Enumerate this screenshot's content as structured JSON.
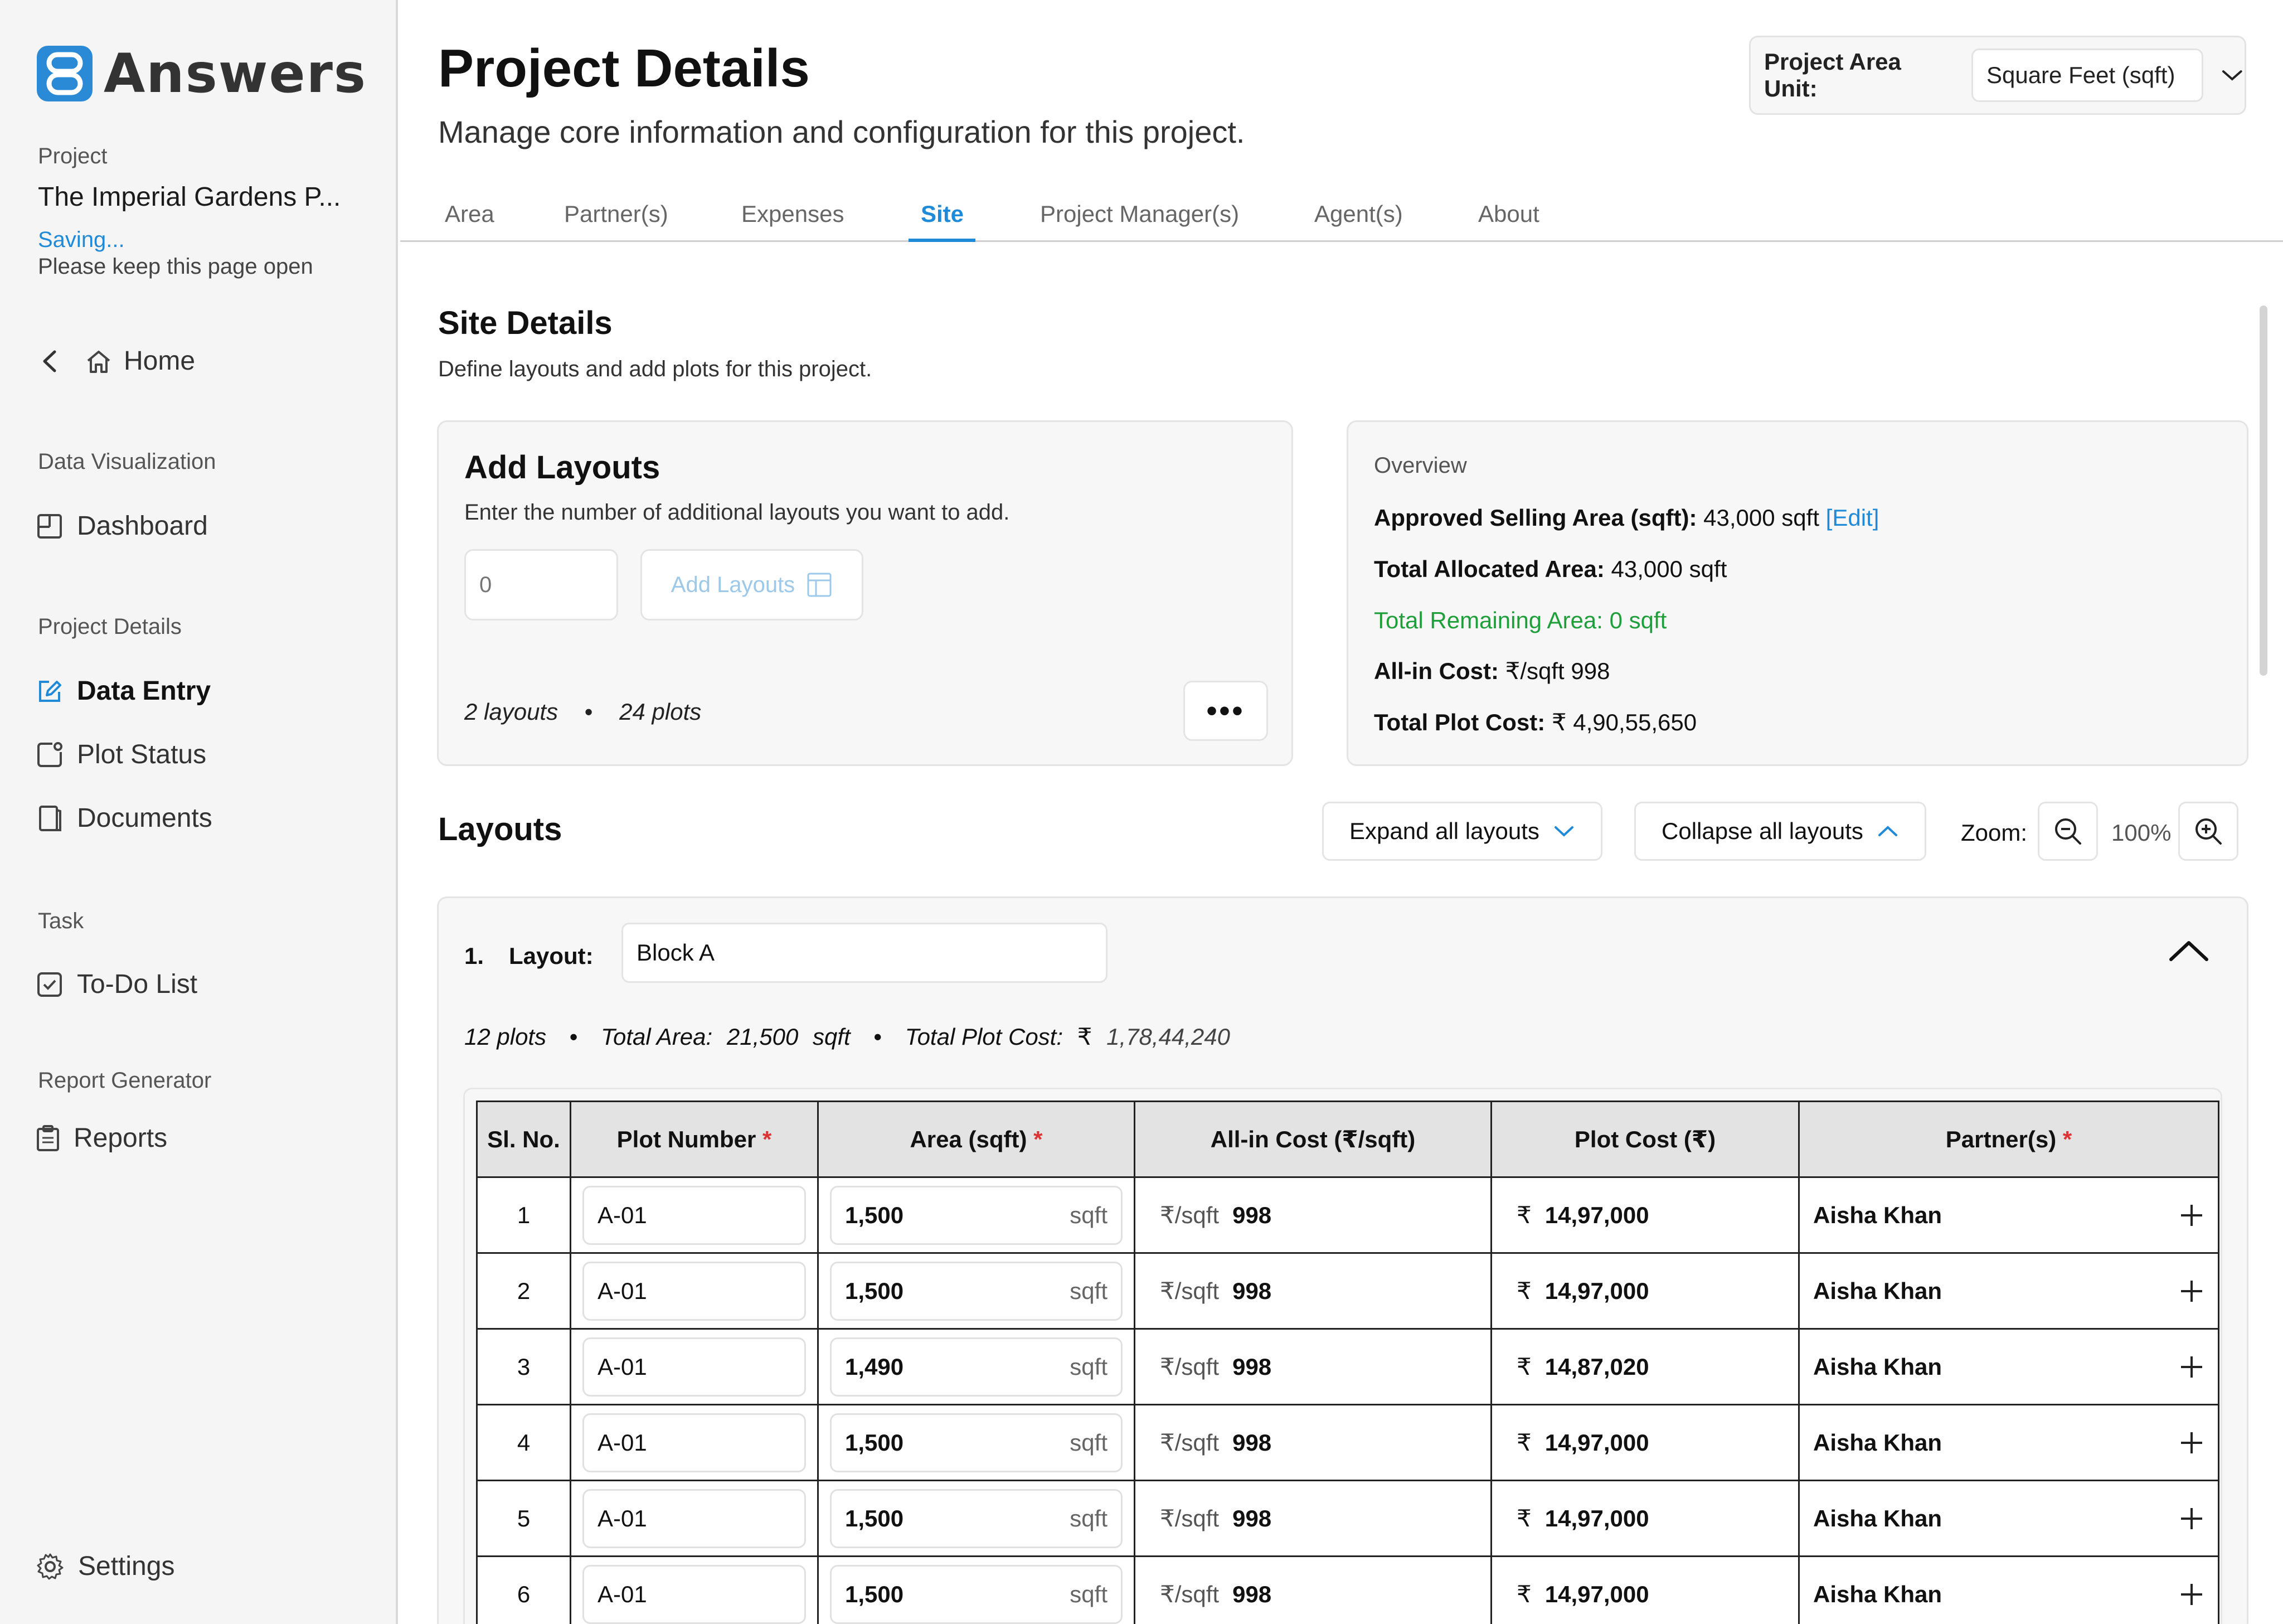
{
  "sidebar": {
    "brand": "Answers",
    "project_label": "Project",
    "project_name": "The Imperial Gardens P...",
    "saving": "Saving...",
    "keep_open": "Please keep this page open",
    "home": "Home",
    "sections": [
      {
        "heading": "Data Visualization",
        "items": [
          "Dashboard"
        ]
      },
      {
        "heading": "Project Details",
        "items": [
          "Data Entry",
          "Plot Status",
          "Documents"
        ]
      },
      {
        "heading": "Task",
        "items": [
          "To-Do List"
        ]
      },
      {
        "heading": "Report Generator",
        "items": [
          "Reports"
        ]
      }
    ],
    "settings": "Settings"
  },
  "header": {
    "title": "Project Details",
    "subtitle": "Manage core information and configuration for this project.",
    "unit_label": "Project Area Unit:",
    "unit_value": "Square Feet (sqft)"
  },
  "tabs": [
    "Area",
    "Partner(s)",
    "Expenses",
    "Site",
    "Project Manager(s)",
    "Agent(s)",
    "About"
  ],
  "active_tab": "Site",
  "site": {
    "title": "Site Details",
    "subtitle": "Define layouts and add plots for this project."
  },
  "add_layouts": {
    "title": "Add Layouts",
    "description": "Enter the number of additional layouts you want to add.",
    "placeholder": "0",
    "button": "Add Layouts",
    "layouts_count": "2 layouts",
    "plots_count": "24 plots",
    "more": "•••"
  },
  "overview": {
    "title": "Overview",
    "approved_label": "Approved Selling Area (sqft):",
    "approved_value": "43,000 sqft",
    "edit": "[Edit]",
    "allocated_label": "Total Allocated Area:",
    "allocated_value": "43,000 sqft",
    "remaining": "Total Remaining Area: 0 sqft",
    "allin_label": "All-in Cost:",
    "allin_value": "₹/sqft 998",
    "plotcost_label": "Total Plot Cost:",
    "plotcost_value": "₹ 4,90,55,650",
    "remaining_color": "#1f9f3a"
  },
  "layouts": {
    "title": "Layouts",
    "expand": "Expand all layouts",
    "collapse": "Collapse all layouts",
    "zoom_label": "Zoom:",
    "zoom_value": "100%"
  },
  "layout1": {
    "index": "1.",
    "label": "Layout:",
    "name": "Block A",
    "plots": "12 plots",
    "total_area_label": "Total Area:",
    "total_area_value": "21,500",
    "total_area_unit": "sqft",
    "total_cost_label": "Total Plot Cost:",
    "total_cost_symbol": "₹",
    "total_cost_value": "1,78,44,240"
  },
  "table": {
    "headers": {
      "sl": "Sl. No.",
      "plot": "Plot Number",
      "area": "Area (sqft)",
      "allin": "All-in Cost (₹/sqft)",
      "cost": "Plot Cost (₹)",
      "partner": "Partner(s)",
      "required_mark": "*"
    },
    "area_unit": "sqft",
    "allin_unit": "₹/sqft",
    "cost_symbol": "₹",
    "rows": [
      {
        "sl": "1",
        "plot": "A-01",
        "area": "1,500",
        "allin": "998",
        "cost": "14,97,000",
        "partner": "Aisha Khan"
      },
      {
        "sl": "2",
        "plot": "A-01",
        "area": "1,500",
        "allin": "998",
        "cost": "14,97,000",
        "partner": "Aisha Khan"
      },
      {
        "sl": "3",
        "plot": "A-01",
        "area": "1,490",
        "allin": "998",
        "cost": "14,87,020",
        "partner": "Aisha Khan"
      },
      {
        "sl": "4",
        "plot": "A-01",
        "area": "1,500",
        "allin": "998",
        "cost": "14,97,000",
        "partner": "Aisha Khan"
      },
      {
        "sl": "5",
        "plot": "A-01",
        "area": "1,500",
        "allin": "998",
        "cost": "14,97,000",
        "partner": "Aisha Khan"
      },
      {
        "sl": "6",
        "plot": "A-01",
        "area": "1,500",
        "allin": "998",
        "cost": "14,97,000",
        "partner": "Aisha Khan"
      }
    ]
  },
  "colors": {
    "accent": "#1f8ad8",
    "brand": "#2a8ad6",
    "required": "#d33333"
  }
}
